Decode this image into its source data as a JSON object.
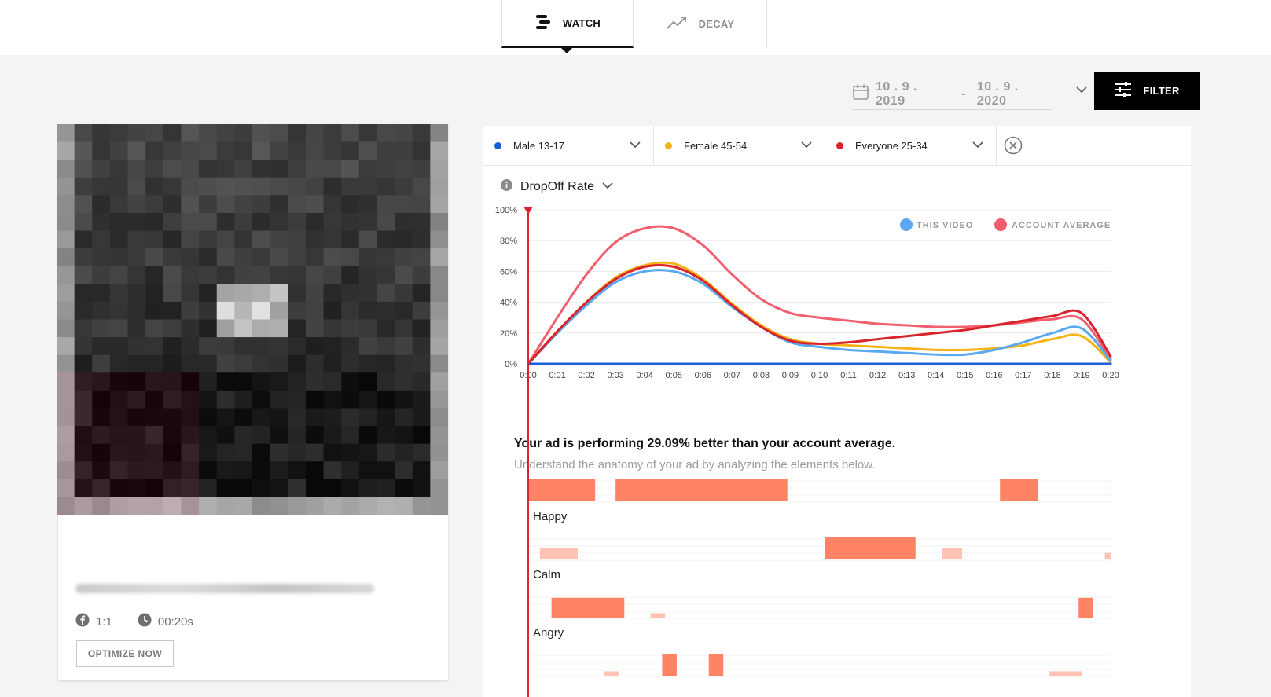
{
  "nav": {
    "tabs": [
      {
        "label": "WATCH",
        "icon": "watch-bars-icon",
        "active": true
      },
      {
        "label": "DECAY",
        "icon": "trend-up-icon",
        "active": false
      }
    ]
  },
  "date_range": {
    "start": "10 . 9 . 2019",
    "separator": "-",
    "end": "10 . 9 . 2020"
  },
  "filter_button": {
    "label": "FILTER"
  },
  "video_card": {
    "aspect": "1:1",
    "duration": "00:20s",
    "optimize_label": "OPTIMIZE NOW"
  },
  "segments": [
    {
      "label": "Male 13-17",
      "color": "#1a5fd6"
    },
    {
      "label": "Female 45-54",
      "color": "#f5b217"
    },
    {
      "label": "Everyone 25-34",
      "color": "#d9232d"
    }
  ],
  "metric": {
    "label": "DropOff Rate"
  },
  "chart_data": {
    "type": "line",
    "ylim": [
      0,
      100
    ],
    "y_ticks": [
      "0%",
      "20%",
      "40%",
      "60%",
      "80%",
      "100%"
    ],
    "x_ticks": [
      "0:00",
      "0:01",
      "0:02",
      "0:03",
      "0:04",
      "0:05",
      "0:06",
      "0:07",
      "0:08",
      "0:09",
      "0:10",
      "0:11",
      "0:12",
      "0:13",
      "0:14",
      "0:15",
      "0:16",
      "0:17",
      "0:18",
      "0:19",
      "0:20"
    ],
    "legend": [
      {
        "name": "THIS VIDEO",
        "color": "#5aa9f0"
      },
      {
        "name": "ACCOUNT AVERAGE",
        "color": "#f25d6d"
      }
    ],
    "legend_position": "top-right",
    "series": [
      {
        "name": "ACCOUNT AVERAGE",
        "color": "#f2606f",
        "values": [
          0,
          30,
          58,
          79,
          88,
          88,
          77,
          58,
          42,
          33,
          30,
          28,
          26,
          25,
          24,
          24,
          25,
          27,
          29,
          29,
          3
        ]
      },
      {
        "name": "Female 45-54",
        "color": "#f5b217",
        "values": [
          0,
          21,
          40,
          56,
          64,
          65,
          55,
          39,
          25,
          16,
          13,
          12,
          11,
          10,
          9,
          9,
          10,
          12,
          16,
          18,
          1
        ]
      },
      {
        "name": "THIS VIDEO",
        "color": "#5aa9f0",
        "values": [
          0,
          20,
          38,
          53,
          60,
          60,
          52,
          37,
          24,
          14,
          11,
          9,
          8,
          7,
          6,
          6,
          9,
          14,
          20,
          23,
          2
        ]
      },
      {
        "name": "Everyone 25-34",
        "color": "#d9232d",
        "values": [
          0,
          21,
          40,
          55,
          63,
          63,
          54,
          38,
          24,
          15,
          13,
          14,
          16,
          18,
          20,
          22,
          25,
          28,
          31,
          33,
          5
        ]
      },
      {
        "name": "Male 13-17",
        "color": "#1a5fd6",
        "values": [
          0,
          0,
          0,
          0,
          0,
          0,
          0,
          0,
          0,
          0,
          0,
          0,
          0,
          0,
          0,
          0,
          0,
          0,
          0,
          0,
          0
        ]
      }
    ],
    "playhead": "0:00"
  },
  "summary": {
    "headline": "Your ad is performing 29.09% better than your account average.",
    "sub": "Understand the anatomy of your ad by analyzing the elements below."
  },
  "emotions": {
    "rows": [
      {
        "label": "Happy",
        "bars": [
          {
            "start": 0.0,
            "end": 2.3,
            "level": 1
          },
          {
            "start": 3.0,
            "end": 8.9,
            "level": 1
          },
          {
            "start": 16.2,
            "end": 17.5,
            "level": 1
          }
        ]
      },
      {
        "label": "Calm",
        "bars": [
          {
            "start": 0.4,
            "end": 1.7,
            "level": 0.5
          },
          {
            "start": 10.2,
            "end": 13.3,
            "level": 1
          },
          {
            "start": 14.2,
            "end": 14.9,
            "level": 0.5
          },
          {
            "start": 19.8,
            "end": 20.0,
            "level": 0.3
          }
        ]
      },
      {
        "label": "Angry",
        "bars": [
          {
            "start": 0.8,
            "end": 3.3,
            "level": 0.9
          },
          {
            "start": 4.2,
            "end": 4.7,
            "level": 0.2
          },
          {
            "start": 18.9,
            "end": 19.4,
            "level": 0.9
          }
        ]
      },
      {
        "label": "",
        "bars": [
          {
            "start": 2.6,
            "end": 3.1,
            "level": 0.2
          },
          {
            "start": 4.6,
            "end": 5.1,
            "level": 1
          },
          {
            "start": 6.2,
            "end": 6.7,
            "level": 1
          },
          {
            "start": 17.9,
            "end": 19.0,
            "level": 0.2
          }
        ]
      }
    ]
  },
  "colors": {
    "accent_black": "#000000",
    "emotion_strong": "#ff8466",
    "emotion_weak": "#ffc2b3",
    "playhead": "#d9232d"
  }
}
